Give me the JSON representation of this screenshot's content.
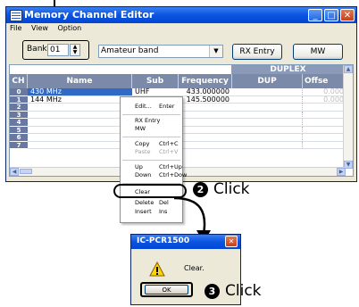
{
  "window": {
    "title": "Memory Channel Editor",
    "menu": [
      "File",
      "View",
      "Option"
    ],
    "bank_label": "Bank",
    "bank_value": "01",
    "bank_name": "Amateur band",
    "rx_entry_label": "RX Entry",
    "mw_label": "MW"
  },
  "grid": {
    "group_header": "DUPLEX",
    "columns": [
      "CH",
      "Name",
      "Sub Name",
      "Frequency",
      "DUP",
      "Offse"
    ],
    "rows": [
      {
        "ch": "0",
        "name": "430 MHz",
        "sub": "UHF",
        "freq": "433.000000",
        "offset": "0.000"
      },
      {
        "ch": "1",
        "name": "144 MHz",
        "sub": "",
        "freq": "145.500000",
        "offset": "0.000"
      },
      {
        "ch": "2",
        "name": "",
        "sub": "",
        "freq": "",
        "offset": ""
      },
      {
        "ch": "3",
        "name": "",
        "sub": "",
        "freq": "",
        "offset": ""
      },
      {
        "ch": "4",
        "name": "",
        "sub": "",
        "freq": "",
        "offset": ""
      },
      {
        "ch": "5",
        "name": "",
        "sub": "",
        "freq": "",
        "offset": ""
      },
      {
        "ch": "6",
        "name": "",
        "sub": "",
        "freq": "",
        "offset": ""
      },
      {
        "ch": "7",
        "name": "",
        "sub": "",
        "freq": "",
        "offset": ""
      }
    ]
  },
  "context_menu": {
    "items": [
      {
        "label": "Edit...",
        "shortcut": "Enter",
        "disabled": false
      },
      {
        "label": "RX Entry",
        "shortcut": "",
        "disabled": false
      },
      {
        "label": "MW",
        "shortcut": "",
        "disabled": false
      },
      {
        "label": "Copy",
        "shortcut": "Ctrl+C",
        "disabled": false
      },
      {
        "label": "Paste",
        "shortcut": "Ctrl+V",
        "disabled": true
      },
      {
        "label": "Up",
        "shortcut": "Ctrl+Up",
        "disabled": false
      },
      {
        "label": "Down",
        "shortcut": "Ctrl+Dow",
        "disabled": false
      },
      {
        "label": "Clear",
        "shortcut": "",
        "disabled": false
      },
      {
        "label": "Delete",
        "shortcut": "Del",
        "disabled": false
      },
      {
        "label": "Insert",
        "shortcut": "Ins",
        "disabled": false
      }
    ]
  },
  "steps": [
    {
      "number": "2",
      "text": "Click"
    },
    {
      "number": "3",
      "text": "Click"
    }
  ],
  "dialog": {
    "title": "IC-PCR1500",
    "message": "Clear.",
    "ok_label": "OK"
  }
}
